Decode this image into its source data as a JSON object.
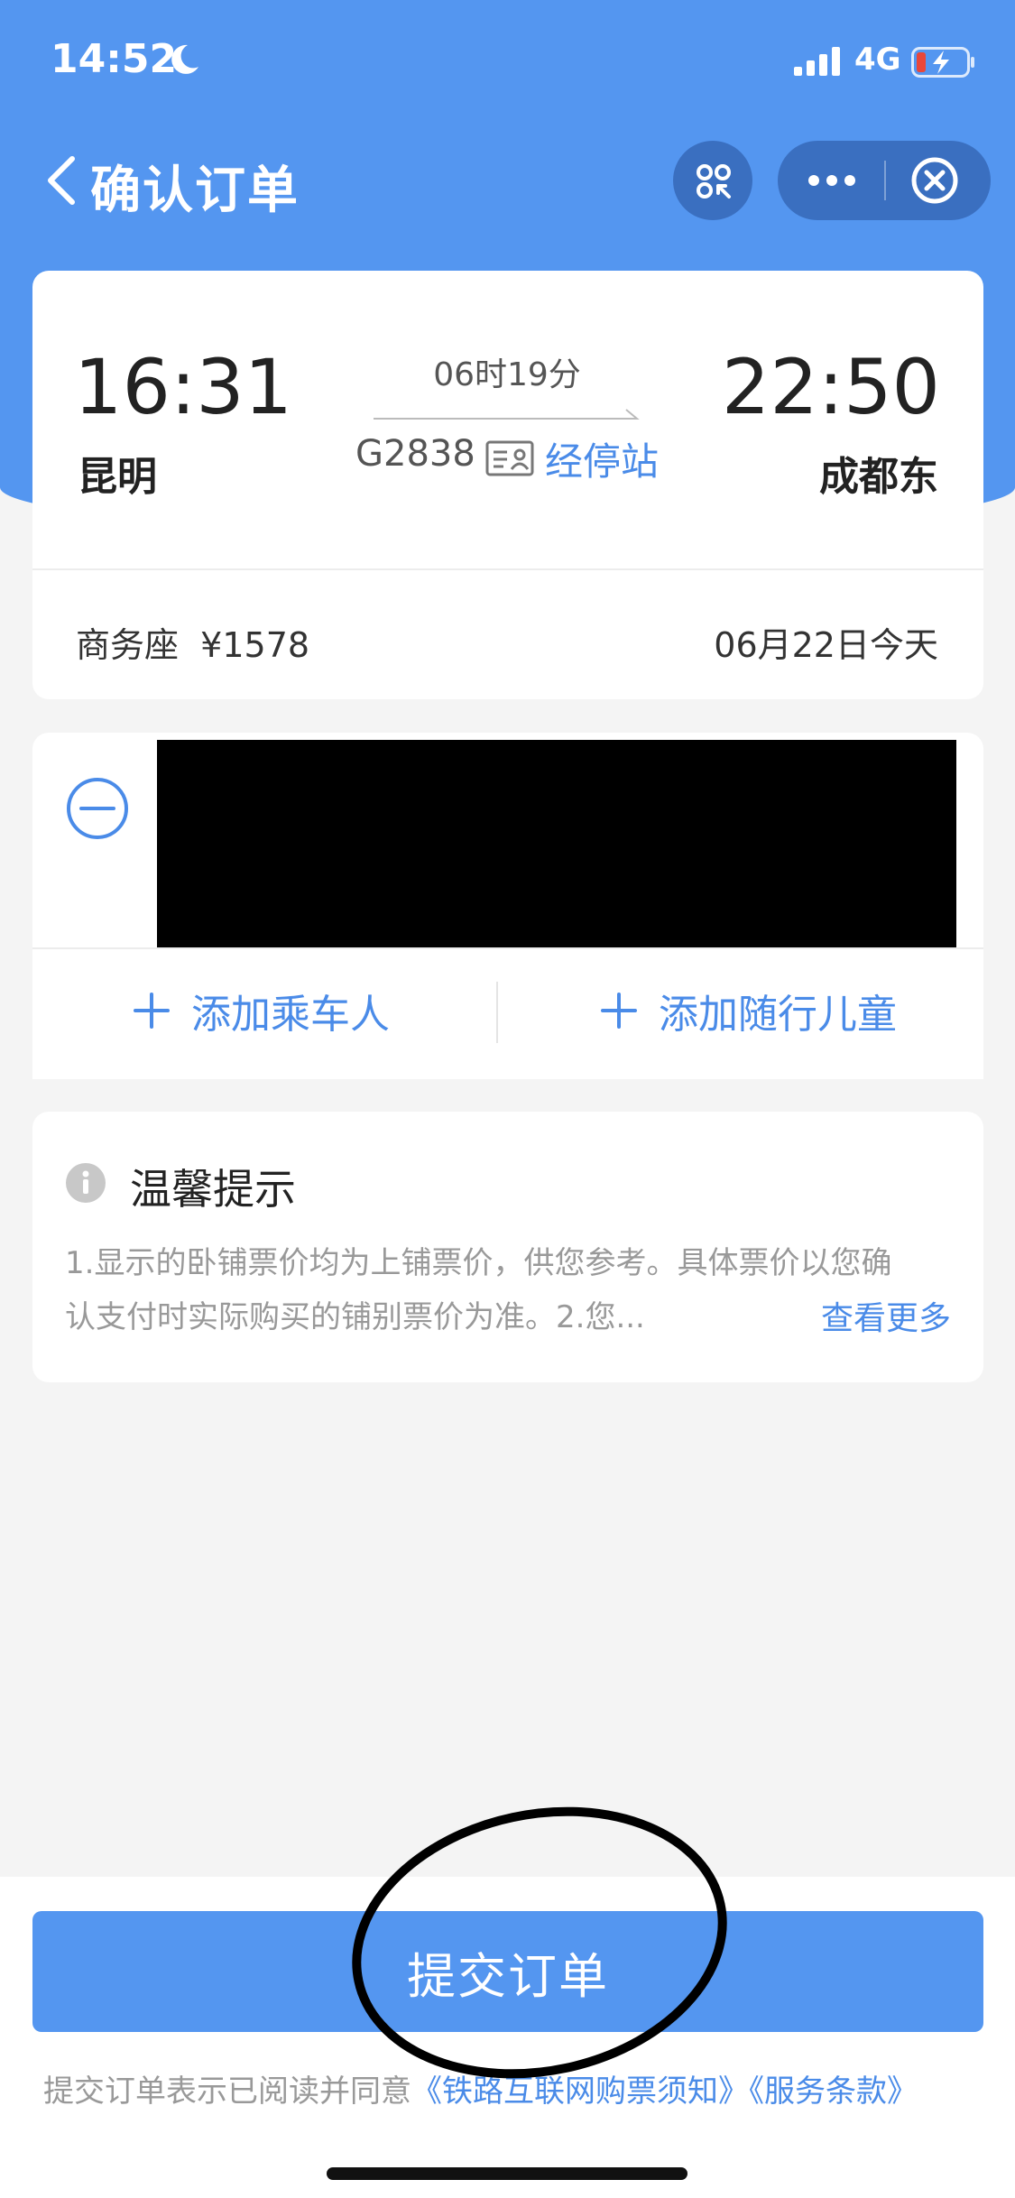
{
  "status_bar": {
    "time": "14:52",
    "network": "4G"
  },
  "nav": {
    "title": "确认订单"
  },
  "trip": {
    "departure_time": "16:31",
    "departure_city": "昆明",
    "arrival_time": "22:50",
    "arrival_city": "成都东",
    "duration": "06时19分",
    "train_number": "G2838",
    "stops_link": "经停站",
    "seat_price": "商务座  ¥1578",
    "date": "06月22日今天"
  },
  "passengers": {
    "add_passenger": "添加乘车人",
    "add_child": "添加随行儿童"
  },
  "tips": {
    "title": "温馨提示",
    "line1": "1.显示的卧铺票价均为上铺票价，供您参考。具体票价以您确",
    "line2": "认支付时实际购买的铺别票价为准。2.您...",
    "more": "查看更多"
  },
  "footer": {
    "submit": "提交订单",
    "agreement_prefix": "提交订单表示已阅读并同意",
    "link_notice": "《铁路互联网购票须知》",
    "link_terms": "《服务条款》"
  },
  "colors": {
    "primary": "#5496f0",
    "link": "#4a8be8",
    "background": "#f4f4f4"
  },
  "icons": [
    "moon-icon",
    "signal-icon",
    "battery-charging-icon",
    "back-chevron-icon",
    "mini-program-icon",
    "more-icon",
    "close-circle-icon",
    "id-card-icon",
    "minus-circle-icon",
    "plus-icon",
    "info-icon"
  ]
}
